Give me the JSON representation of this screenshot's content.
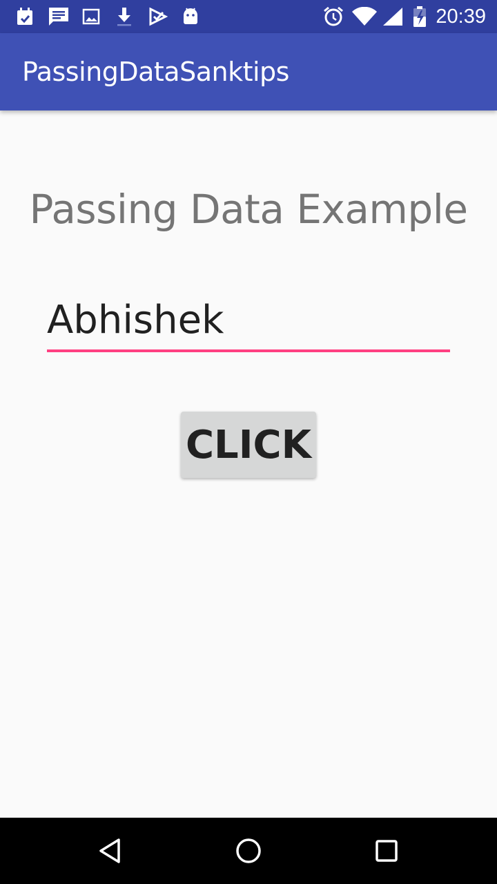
{
  "status_bar": {
    "time": "20:39",
    "left_icons": [
      "calendar-icon",
      "message-icon",
      "image-icon",
      "download-icon",
      "check-icon",
      "android-icon"
    ],
    "right_icons": [
      "alarm-icon",
      "wifi-icon",
      "signal-icon",
      "battery-charging-icon"
    ],
    "background": "#303f9f"
  },
  "app_bar": {
    "title": "PassingDataSanktips",
    "background": "#3f51b5"
  },
  "main": {
    "heading": "Passing Data Example",
    "name_input": {
      "value": "Abhishek",
      "accent": "#ff4081"
    },
    "button_label": "CLICK"
  },
  "nav_bar": {
    "buttons": [
      "back-icon",
      "home-icon",
      "recents-icon"
    ]
  }
}
